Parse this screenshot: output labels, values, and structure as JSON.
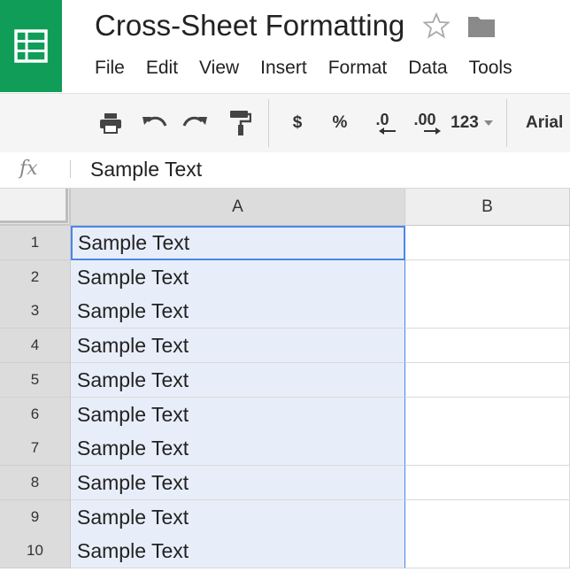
{
  "app": {
    "icon": "sheets-logo-icon",
    "brand_color": "#0f9d58"
  },
  "document": {
    "title": "Cross-Sheet Formatting"
  },
  "menu": [
    "File",
    "Edit",
    "View",
    "Insert",
    "Format",
    "Data",
    "Tools"
  ],
  "toolbar": {
    "currency": "$",
    "percent": "%",
    "decrease_decimal": ".0",
    "increase_decimal": ".00",
    "more_formats": "123",
    "font": "Arial"
  },
  "formula_bar": {
    "fx_label": "fx",
    "value": "Sample Text"
  },
  "grid": {
    "columns": [
      "A",
      "B"
    ],
    "rows": [
      {
        "num": "1",
        "a": "Sample Text",
        "b": ""
      },
      {
        "num": "2",
        "a": "Sample Text",
        "b": ""
      },
      {
        "num": "3",
        "a": "Sample Text",
        "b": ""
      },
      {
        "num": "4",
        "a": "Sample Text",
        "b": ""
      },
      {
        "num": "5",
        "a": "Sample Text",
        "b": ""
      },
      {
        "num": "6",
        "a": "Sample Text",
        "b": ""
      },
      {
        "num": "7",
        "a": "Sample Text",
        "b": ""
      },
      {
        "num": "8",
        "a": "Sample Text",
        "b": ""
      },
      {
        "num": "9",
        "a": "Sample Text",
        "b": ""
      },
      {
        "num": "10",
        "a": "Sample Text",
        "b": ""
      }
    ],
    "selection_color": "#4a86e8"
  }
}
